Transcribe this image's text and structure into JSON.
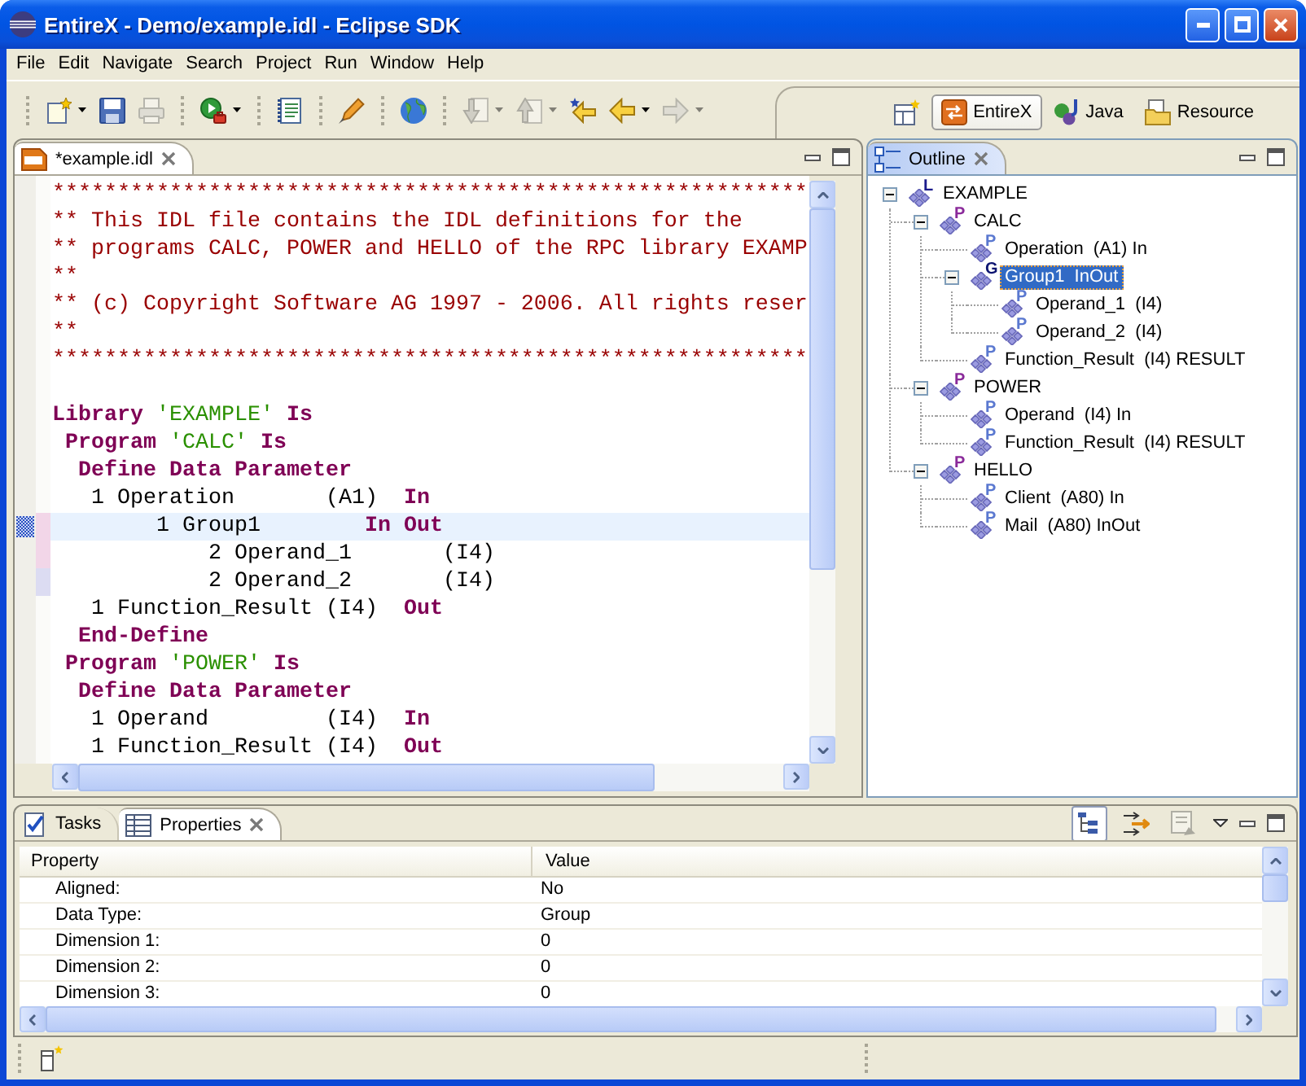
{
  "window": {
    "title": "EntireX - Demo/example.idl - Eclipse SDK"
  },
  "menu": [
    "File",
    "Edit",
    "Navigate",
    "Search",
    "Project",
    "Run",
    "Window",
    "Help"
  ],
  "toolbar": {
    "groups": [
      {
        "buttons": [
          {
            "kind": "new",
            "dropdown": true,
            "disabled": false
          },
          {
            "kind": "save",
            "dropdown": false,
            "disabled": false
          },
          {
            "kind": "print",
            "dropdown": false,
            "disabled": true
          }
        ]
      },
      {
        "buttons": [
          {
            "kind": "run",
            "dropdown": true,
            "disabled": false
          }
        ]
      },
      {
        "buttons": [
          {
            "kind": "document",
            "dropdown": false,
            "disabled": false
          }
        ]
      },
      {
        "buttons": [
          {
            "kind": "marker",
            "dropdown": false,
            "disabled": false
          }
        ]
      },
      {
        "buttons": [
          {
            "kind": "globe",
            "dropdown": false,
            "disabled": false
          }
        ]
      },
      {
        "buttons": [
          {
            "kind": "next-annotation",
            "dropdown": true,
            "disabled": true
          },
          {
            "kind": "previous-annotation",
            "dropdown": true,
            "disabled": true
          },
          {
            "kind": "last-edit",
            "dropdown": false,
            "disabled": false
          },
          {
            "kind": "back",
            "dropdown": true,
            "disabled": false
          },
          {
            "kind": "forward",
            "dropdown": true,
            "disabled": true
          }
        ]
      }
    ]
  },
  "perspectives": [
    {
      "kind": "entirex",
      "label": "EntireX",
      "selected": true
    },
    {
      "kind": "java",
      "label": "Java",
      "selected": false
    },
    {
      "kind": "resource",
      "label": "Resource",
      "selected": false
    }
  ],
  "editor": {
    "tab": {
      "label": "*example.idl",
      "selected": true
    },
    "lines": [
      {
        "kind": "code",
        "current": false,
        "tokens": [
          {
            "kind": "comment",
            "text": "**********************************************************"
          }
        ]
      },
      {
        "kind": "code",
        "current": false,
        "tokens": [
          {
            "kind": "comment",
            "text": "** This IDL file contains the IDL definitions for the"
          }
        ]
      },
      {
        "kind": "code",
        "current": false,
        "tokens": [
          {
            "kind": "comment",
            "text": "** programs CALC, POWER and HELLO of the RPC library EXAMP"
          }
        ]
      },
      {
        "kind": "code",
        "current": false,
        "tokens": [
          {
            "kind": "comment",
            "text": "**"
          }
        ]
      },
      {
        "kind": "code",
        "current": false,
        "tokens": [
          {
            "kind": "comment",
            "text": "** (c) Copyright Software AG 1997 - 2006. All rights reser"
          }
        ]
      },
      {
        "kind": "code",
        "current": false,
        "tokens": [
          {
            "kind": "comment",
            "text": "**"
          }
        ]
      },
      {
        "kind": "code",
        "current": false,
        "tokens": [
          {
            "kind": "comment",
            "text": "**********************************************************"
          }
        ]
      },
      {
        "kind": "blank"
      },
      {
        "kind": "code",
        "current": false,
        "tokens": [
          {
            "kind": "keyword",
            "text": "Library"
          },
          {
            "kind": "string",
            "text": " 'EXAMPLE'"
          },
          {
            "kind": "keyword",
            "text": " Is"
          }
        ]
      },
      {
        "kind": "code",
        "current": false,
        "tokens": [
          {
            "kind": "keyword",
            "text": " Program"
          },
          {
            "kind": "string",
            "text": " 'CALC'"
          },
          {
            "kind": "keyword",
            "text": " Is"
          }
        ]
      },
      {
        "kind": "code",
        "current": false,
        "tokens": [
          {
            "kind": "keyword",
            "text": "  Define Data Parameter"
          }
        ]
      },
      {
        "kind": "code",
        "current": false,
        "tokens": [
          {
            "kind": "plain",
            "text": "   1 Operation       (A1)"
          },
          {
            "kind": "keyword",
            "text": "  In"
          }
        ]
      },
      {
        "kind": "code",
        "current": true,
        "color": "#f2d6e8",
        "tokens": [
          {
            "kind": "plain",
            "text": "        1 Group1"
          },
          {
            "kind": "keyword",
            "text": "        In Out"
          }
        ]
      },
      {
        "kind": "code",
        "current": false,
        "color": "#f2d6e8",
        "tokens": [
          {
            "kind": "plain",
            "text": "            2 Operand_1       (I4)"
          }
        ]
      },
      {
        "kind": "code",
        "current": false,
        "color": "#dcdcf2",
        "tokens": [
          {
            "kind": "plain",
            "text": "            2 Operand_2       (I4)"
          }
        ]
      },
      {
        "kind": "code",
        "current": false,
        "tokens": [
          {
            "kind": "plain",
            "text": "   1 Function_Result (I4)"
          },
          {
            "kind": "keyword",
            "text": "  Out"
          }
        ]
      },
      {
        "kind": "code",
        "current": false,
        "tokens": [
          {
            "kind": "keyword",
            "text": "  End-Define"
          }
        ]
      },
      {
        "kind": "code",
        "current": false,
        "tokens": [
          {
            "kind": "keyword",
            "text": " Program"
          },
          {
            "kind": "string",
            "text": " 'POWER'"
          },
          {
            "kind": "keyword",
            "text": " Is"
          }
        ]
      },
      {
        "kind": "code",
        "current": false,
        "tokens": [
          {
            "kind": "keyword",
            "text": "  Define Data Parameter"
          }
        ]
      },
      {
        "kind": "code",
        "current": false,
        "tokens": [
          {
            "kind": "plain",
            "text": "   1 Operand         (I4)"
          },
          {
            "kind": "keyword",
            "text": "  In"
          }
        ]
      },
      {
        "kind": "code",
        "current": false,
        "tokens": [
          {
            "kind": "plain",
            "text": "   1 Function_Result (I4)"
          },
          {
            "kind": "keyword",
            "text": "  Out"
          }
        ]
      }
    ]
  },
  "outline": {
    "tab": {
      "label": "Outline",
      "selected": true
    },
    "tree": [
      {
        "label": "EXAMPLE",
        "kind": "library",
        "letter": "L",
        "expanded": true,
        "selected": false,
        "children": [
          {
            "label": "CALC",
            "kind": "program",
            "letter": "P",
            "expanded": true,
            "selected": false,
            "children": [
              {
                "label": "Operation  (A1) In",
                "kind": "parameter",
                "letter": "P",
                "selected": false
              },
              {
                "label": "Group1  InOut",
                "kind": "group",
                "letter": "G",
                "expanded": true,
                "selected": true,
                "children": [
                  {
                    "label": "Operand_1  (I4)",
                    "kind": "parameter",
                    "letter": "P",
                    "selected": false
                  },
                  {
                    "label": "Operand_2  (I4)",
                    "kind": "parameter",
                    "letter": "P",
                    "selected": false
                  }
                ]
              },
              {
                "label": "Function_Result  (I4) RESULT",
                "kind": "parameter",
                "letter": "P",
                "selected": false
              }
            ]
          },
          {
            "label": "POWER",
            "kind": "program",
            "letter": "P",
            "expanded": true,
            "selected": false,
            "children": [
              {
                "label": "Operand  (I4) In",
                "kind": "parameter",
                "letter": "P",
                "selected": false
              },
              {
                "label": "Function_Result  (I4) RESULT",
                "kind": "parameter",
                "letter": "P",
                "selected": false
              }
            ]
          },
          {
            "label": "HELLO",
            "kind": "program",
            "letter": "P",
            "expanded": true,
            "selected": false,
            "children": [
              {
                "label": "Client  (A80) In",
                "kind": "parameter",
                "letter": "P",
                "selected": false
              },
              {
                "label": "Mail  (A80) InOut",
                "kind": "parameter",
                "letter": "P",
                "selected": false
              }
            ]
          }
        ]
      }
    ]
  },
  "bottom_panel": {
    "tabs": [
      {
        "kind": "tasks",
        "label": "Tasks",
        "selected": false
      },
      {
        "kind": "properties",
        "label": "Properties",
        "selected": true
      }
    ],
    "toolbar": [
      {
        "kind": "categories",
        "on": true,
        "disabled": false
      },
      {
        "kind": "advanced",
        "on": false,
        "disabled": false
      },
      {
        "kind": "defaults",
        "on": false,
        "disabled": true
      }
    ],
    "table": {
      "columns": [
        "Property",
        "Value"
      ],
      "rows": [
        [
          "Aligned:",
          "No"
        ],
        [
          "Data Type:",
          "Group"
        ],
        [
          "Dimension 1:",
          "0"
        ],
        [
          "Dimension 2:",
          "0"
        ],
        [
          "Dimension 3:",
          "0"
        ]
      ]
    }
  }
}
